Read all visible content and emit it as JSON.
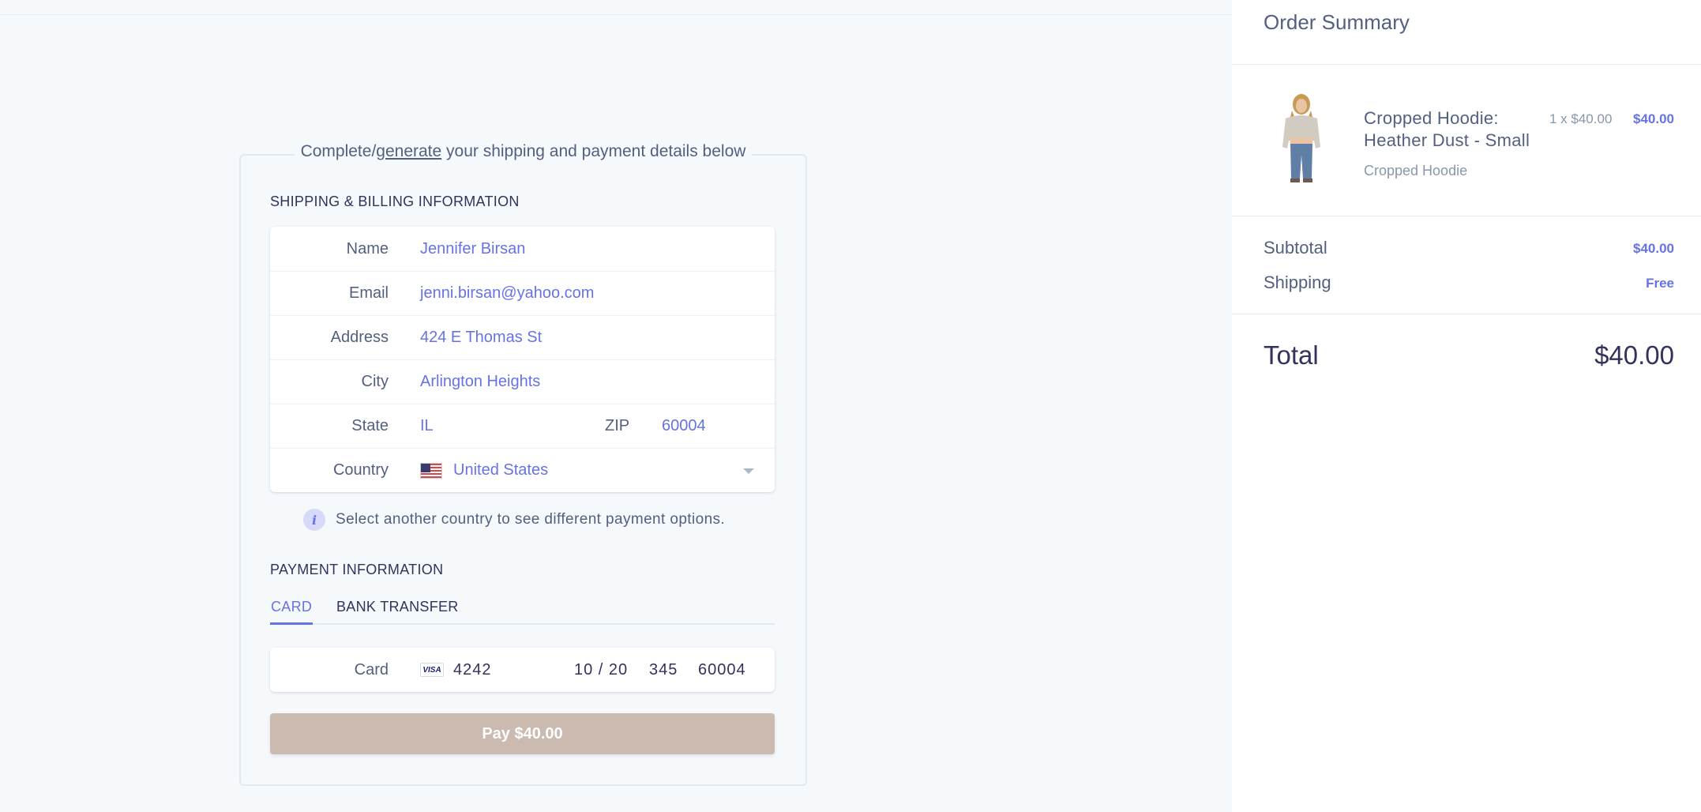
{
  "legend": {
    "prefix": "Complete/",
    "link": "generate",
    "suffix": " your shipping and payment details below"
  },
  "shipping": {
    "title": "Shipping & Billing Information",
    "name_label": "Name",
    "name_value": "Jennifer Birsan",
    "email_label": "Email",
    "email_value": "jenni.birsan@yahoo.com",
    "address_label": "Address",
    "address_value": "424 E Thomas St",
    "city_label": "City",
    "city_value": "Arlington Heights",
    "state_label": "State",
    "state_value": "IL",
    "zip_label": "ZIP",
    "zip_value": "60004",
    "country_label": "Country",
    "country_value": "United States",
    "country_flag_icon": "us-flag-icon"
  },
  "notice": {
    "text": "Select another country to see different payment options.",
    "icon": "info-icon"
  },
  "payment": {
    "title": "Payment Information",
    "tabs": [
      {
        "label": "Card",
        "active": true
      },
      {
        "label": "Bank Transfer",
        "active": false
      }
    ],
    "card_label": "Card",
    "card_brand": "VISA",
    "card_number": "4242",
    "card_expiry": "10 / 20",
    "card_cvc": "345",
    "card_zip": "60004",
    "pay_button": "Pay $40.00",
    "pay_button_color": "#cbbab0"
  },
  "summary": {
    "title": "Order Summary",
    "item": {
      "name": "Cropped Hoodie: Heather Dust - Small",
      "subtitle": "Cropped Hoodie",
      "quantity": "1 x $40.00",
      "price": "$40.00"
    },
    "subtotal_label": "Subtotal",
    "subtotal_value": "$40.00",
    "shipping_label": "Shipping",
    "shipping_value": "Free",
    "total_label": "Total",
    "total_value": "$40.00"
  },
  "colors": {
    "accent": "#6772e5",
    "text": "#525f7f",
    "heading": "#32325d",
    "background": "#f6f9fc"
  }
}
